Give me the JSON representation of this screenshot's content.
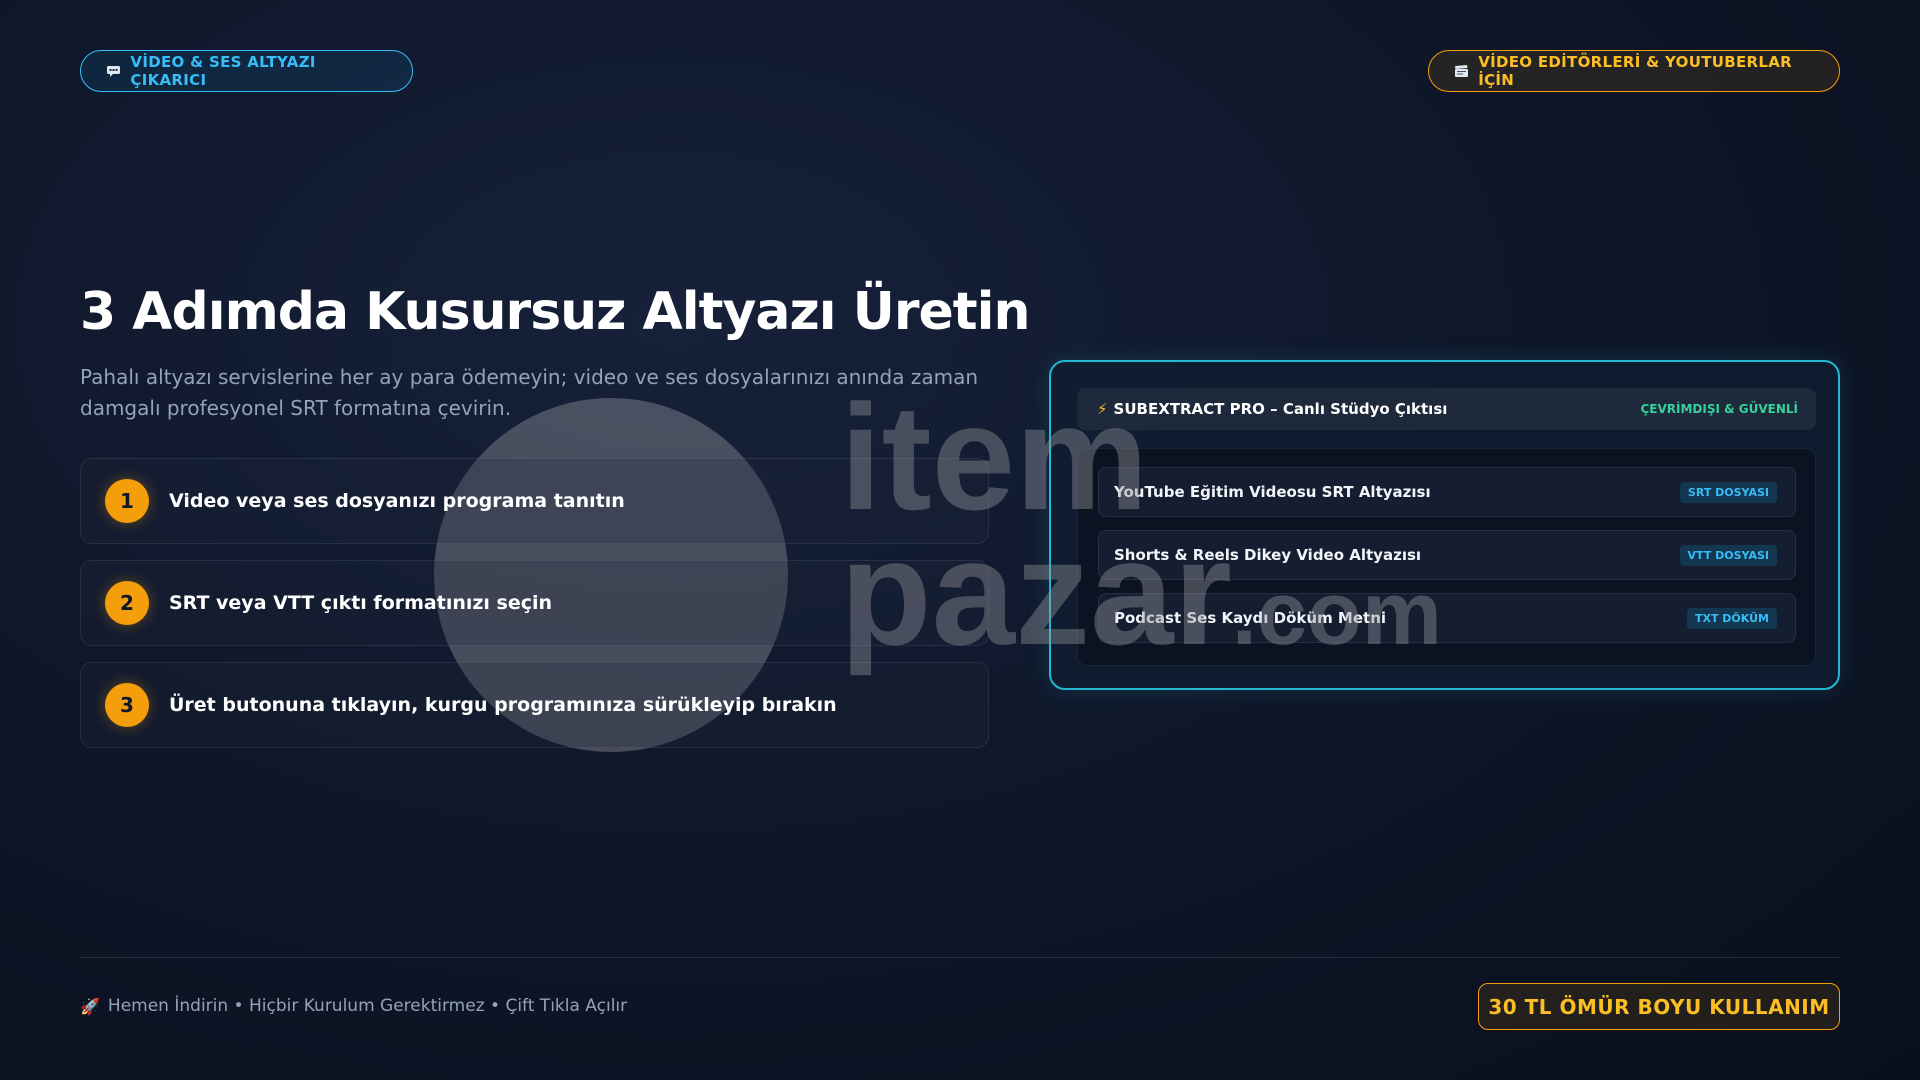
{
  "top_left_pill": {
    "icon": "speech-bubble-icon",
    "label": "VİDEO & SES ALTYAZI ÇIKARICI"
  },
  "top_right_pill": {
    "icon": "clapperboard-icon",
    "label": "VİDEO EDİTÖRLERİ & YOUTUBERLAR İÇİN"
  },
  "heading": {
    "title": "3 Adımda Kusursuz Altyazı Üretin",
    "subtitle": "Pahalı altyazı servislerine her ay para ödemeyin; video ve ses dosyalarınızı anında zaman damgalı profesyonel SRT formatına çevirin."
  },
  "steps": [
    {
      "number": "1",
      "text": "Video veya ses dosyanızı programa tanıtın"
    },
    {
      "number": "2",
      "text": "SRT veya VTT çıktı formatınızı seçin"
    },
    {
      "number": "3",
      "text": "Üret butonuna tıklayın, kurgu programınıza sürükleyip bırakın"
    }
  ],
  "panel": {
    "header_icon": "lightning-icon",
    "title": "SUBEXTRACT PRO – Canlı Stüdyo Çıktısı",
    "status": "ÇEVRİMDIŞI & GÜVENLİ",
    "rows": [
      {
        "label": "YouTube Eğitim Videosu SRT Altyazısı",
        "badge": "SRT DOSYASI"
      },
      {
        "label": "Shorts & Reels Dikey Video Altyazısı",
        "badge": "VTT DOSYASI"
      },
      {
        "label": "Podcast Ses Kaydı Döküm Metni",
        "badge": "TXT DÖKÜM"
      }
    ]
  },
  "watermark": {
    "line1": "item",
    "line2": "pazar",
    "suffix": ".com"
  },
  "footer": {
    "icon": "rocket-icon",
    "text": "Hemen İndirin • Hiçbir Kurulum Gerektirmez • Çift Tıkla Açılır",
    "cta": "30 TL ÖMÜR BOYU KULLANIM"
  },
  "colors": {
    "background": "#0f172a",
    "accent_blue": "#38bdf8",
    "accent_amber": "#f59e0b",
    "accent_teal": "#22b8cf",
    "status_green": "#34d399"
  }
}
